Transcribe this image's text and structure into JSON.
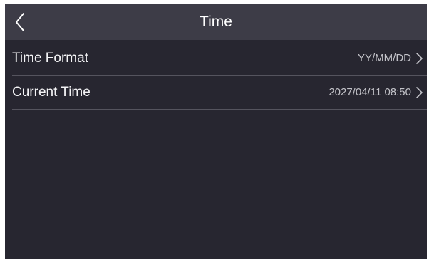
{
  "header": {
    "title": "Time",
    "back_icon": "chevron-left-icon"
  },
  "settings": [
    {
      "label": "Time Format",
      "value": "YY/MM/DD",
      "icon": "chevron-right-icon"
    },
    {
      "label": "Current Time",
      "value": "2027/04/11 08:50",
      "icon": "chevron-right-icon"
    }
  ],
  "colors": {
    "background": "#272630",
    "title_bar": "#3d3c47",
    "divider": "#55545e",
    "text_primary": "#f4f4f6",
    "text_secondary": "#c3c3c9"
  }
}
